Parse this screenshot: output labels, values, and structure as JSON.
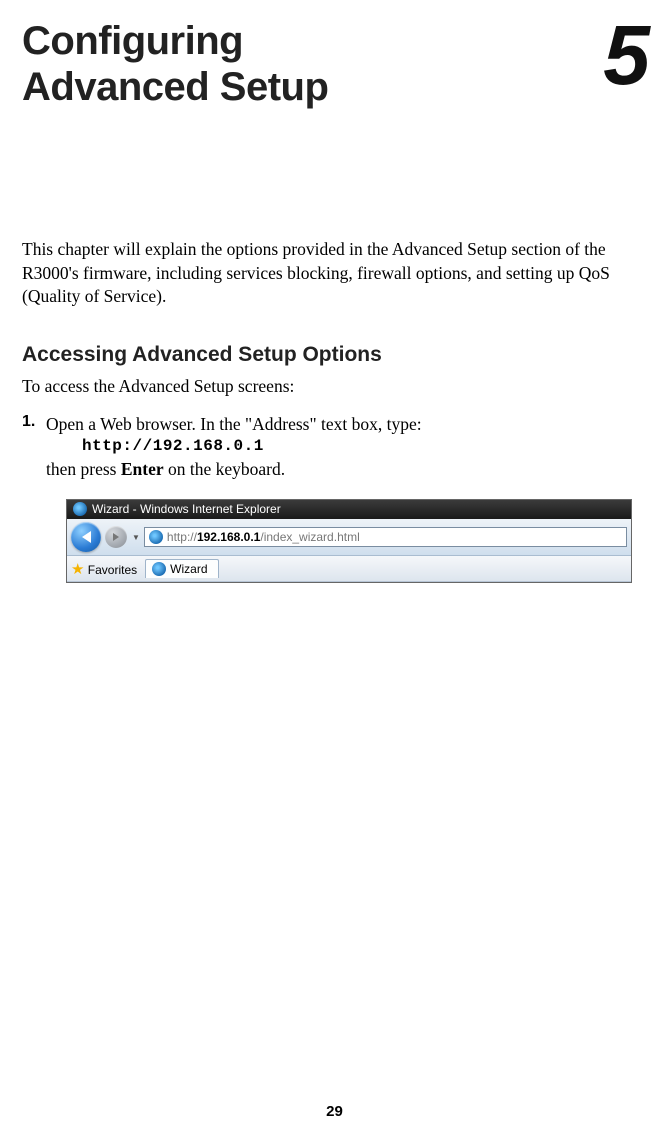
{
  "chapter": {
    "title_line1": "Configuring",
    "title_line2": "Advanced Setup",
    "number": "5"
  },
  "intro": "This chapter will explain the options provided in the Advanced Setup section of the R3000's firmware, including services blocking, firewall options, and setting up QoS (Quality of Service).",
  "section1": {
    "heading": "Accessing Advanced Setup Options",
    "lead": "To access the Advanced Setup screens:"
  },
  "step1": {
    "num": "1.",
    "text_a": "Open a Web browser. In the \"Address\" text box, type:",
    "url": "http://192.168.0.1",
    "text_b_pre": "then press ",
    "text_b_bold": "Enter",
    "text_b_post": " on the keyboard."
  },
  "browser": {
    "window_title": "Wizard - Windows Internet Explorer",
    "addr_prefix": "http://",
    "addr_bold": "192.168.0.1",
    "addr_suffix": "/index_wizard.html",
    "favorites_label": "Favorites",
    "tab_label": "Wizard"
  },
  "page_number": "29"
}
